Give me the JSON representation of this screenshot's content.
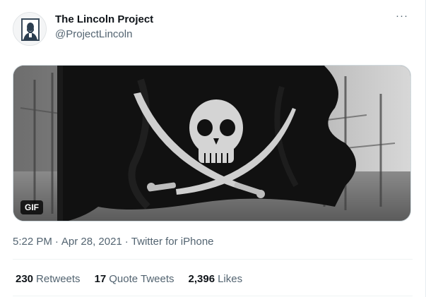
{
  "author": {
    "name": "The Lincoln Project",
    "handle": "@ProjectLincoln",
    "avatar_icon": "lincoln-portrait-icon"
  },
  "menu": {
    "icon": "more-dots-icon",
    "glyph": "···"
  },
  "media": {
    "badge": "GIF",
    "description_icon": "pirate-flag-gif"
  },
  "meta": {
    "time": "5:22 PM",
    "separator": "·",
    "date": "Apr 28, 2021",
    "source": "Twitter for iPhone"
  },
  "stats": [
    {
      "count": "230",
      "label": "Retweets"
    },
    {
      "count": "17",
      "label": "Quote Tweets"
    },
    {
      "count": "2,396",
      "label": "Likes"
    }
  ],
  "colors": {
    "text_primary": "#0f1419",
    "text_secondary": "#536471",
    "border": "#cfd9de"
  }
}
